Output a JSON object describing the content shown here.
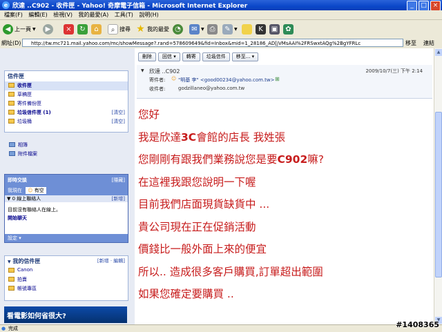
{
  "window": {
    "title": "欣達 ..C902 - 收件匣 - Yahoo! 奇摩電子信箱 - Microsoft Internet Explorer",
    "minimize": "_",
    "maximize": "□",
    "close": "×"
  },
  "menu": [
    "檔案(F)",
    "編輯(E)",
    "檢視(V)",
    "我的最愛(A)",
    "工具(T)",
    "說明(H)"
  ],
  "toolbar": {
    "back": "上一頁",
    "search": "搜尋",
    "favorites": "我的最愛"
  },
  "address": {
    "label": "網址(D)",
    "url": "http://tw.mc721.mail.yahoo.com/mc/showMessage?.rand=578609649&fid=Inbox&mid=1_28186_AD[jVMsAAI%2FRSwxtAQg%2BgYFRLc",
    "go": "移至",
    "links": "連結"
  },
  "sidebar": {
    "folders_title": "信件匣",
    "folders": [
      {
        "label": "收件匣",
        "clear": ""
      },
      {
        "label": "草稿匣",
        "clear": ""
      },
      {
        "label": "寄件備份匣",
        "clear": ""
      },
      {
        "label": "垃圾信件匣 (1)",
        "clear": "[清空]"
      },
      {
        "label": "垃圾桶",
        "clear": "[清空]"
      }
    ],
    "extras": [
      "相簿",
      "附件檔案"
    ],
    "chat": {
      "title": "即時交談",
      "hide": "[隱藏]",
      "status_label": "我現在",
      "status_value": "有空",
      "online_label": "▼ 0 線上聯絡人",
      "add_link": "[新增]",
      "empty_text": "目前沒有聯絡人在線上。",
      "start_chat": "開始聊天",
      "settings": "設定 ▾"
    },
    "my_folders": {
      "title": "我的信件匣",
      "actions": "[新增 · 編輯]",
      "items": [
        "Canon",
        "拍賣",
        "帳號專區"
      ]
    },
    "ad_text": "看電影如何省很大?"
  },
  "message": {
    "buttons": [
      "刪除",
      "回信 ▾",
      "轉寄",
      "垃圾信件",
      "移至... ▾"
    ],
    "subject": "欣達 ..C902",
    "date": "2009/10/7(三) 下午 2:14",
    "from_label": "寄件者:",
    "from_value": "\"明基 李\" <good00234@yahoo.com.tw>",
    "to_label": "收件者:",
    "to_value": "godzillaneo@yahoo.com.tw",
    "lines": [
      {
        "a": "您好",
        "b": "",
        "c": ""
      },
      {
        "a": "我是欣達",
        "b": "3C",
        "c": "會館的店長 我姓張"
      },
      {
        "a": "您剛剛有跟我們業務說您是要",
        "b": "C902",
        "c": "嘛?"
      },
      {
        "a": "在這裡我跟您說明一下喔",
        "b": "",
        "c": ""
      },
      {
        "a": "目前我們店面現貨缺貨中 ...",
        "b": "",
        "c": ""
      },
      {
        "a": "貴公司現在正在促銷活動",
        "b": "",
        "c": ""
      },
      {
        "a": "價錢比一般外面上來的便宜",
        "b": "",
        "c": ""
      },
      {
        "a": "所以.. 造成很多客戶購買,訂單超出範圍",
        "b": "",
        "c": ""
      },
      {
        "a": "如果您確定要購買 ..",
        "b": "",
        "c": ""
      }
    ]
  },
  "status": {
    "text": "完成"
  },
  "watermark": "#1408365"
}
